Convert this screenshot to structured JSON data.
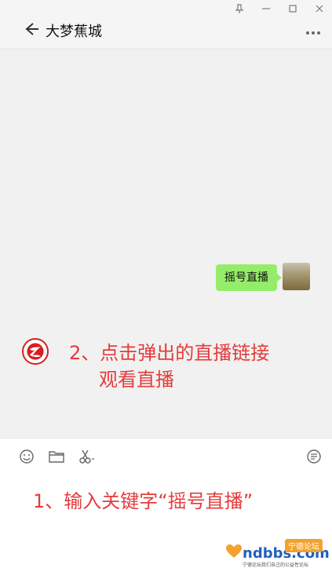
{
  "header": {
    "title": "大梦蕉城"
  },
  "chat": {
    "message": "摇号直播",
    "annotation2_line1": "2、点击弹出的直播链接",
    "annotation2_line2": "观看直播"
  },
  "input": {
    "annotation1": "1、输入关键字“摇号直播”"
  },
  "watermark": {
    "domain": "ndbbs.com",
    "badge": "宁德论坛",
    "tagline": "宁德论坛我们自己的公益性论坛"
  },
  "colors": {
    "bubble": "#95ec69",
    "annotation": "#e53b3b",
    "logo_red": "#d71f1f"
  },
  "icons": [
    "back-arrow-icon",
    "more-icon",
    "emoji-icon",
    "folder-icon",
    "scissors-icon",
    "chat-history-icon",
    "pin-icon",
    "minimize-icon",
    "maximize-icon",
    "close-icon"
  ]
}
